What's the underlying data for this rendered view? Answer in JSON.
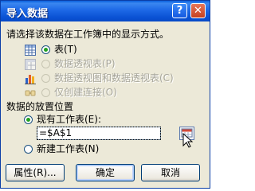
{
  "dialog": {
    "title": "导入数据",
    "help_symbol": "?",
    "close_symbol": "✕"
  },
  "display_section": {
    "label": "请选择该数据在工作簿中的显示方式。",
    "options": [
      {
        "label": "表(T)",
        "icon": "table-icon",
        "selected": true,
        "enabled": true
      },
      {
        "label": "数据透视表(P)",
        "icon": "pivot-table-icon",
        "selected": false,
        "enabled": false
      },
      {
        "label": "数据透视图和数据透视表(C)",
        "icon": "pivot-chart-icon",
        "selected": false,
        "enabled": false
      },
      {
        "label": "仅创建连接(O)",
        "icon": "connection-icon",
        "selected": false,
        "enabled": false
      }
    ]
  },
  "placement_section": {
    "label": "数据的放置位置",
    "existing_sheet_label": "现有工作表(E):",
    "existing_sheet_selected": true,
    "cell_reference_value": "=$A$1",
    "new_sheet_label": "新建工作表(N)",
    "new_sheet_selected": false
  },
  "buttons": {
    "properties": "属性(R)...",
    "ok": "确定",
    "cancel": "取消"
  },
  "colors": {
    "title_bar": "#0a52d4",
    "radio_dot": "#21a121",
    "disabled_text": "#a7a69b",
    "dialog_bg": "#ece9d8"
  }
}
